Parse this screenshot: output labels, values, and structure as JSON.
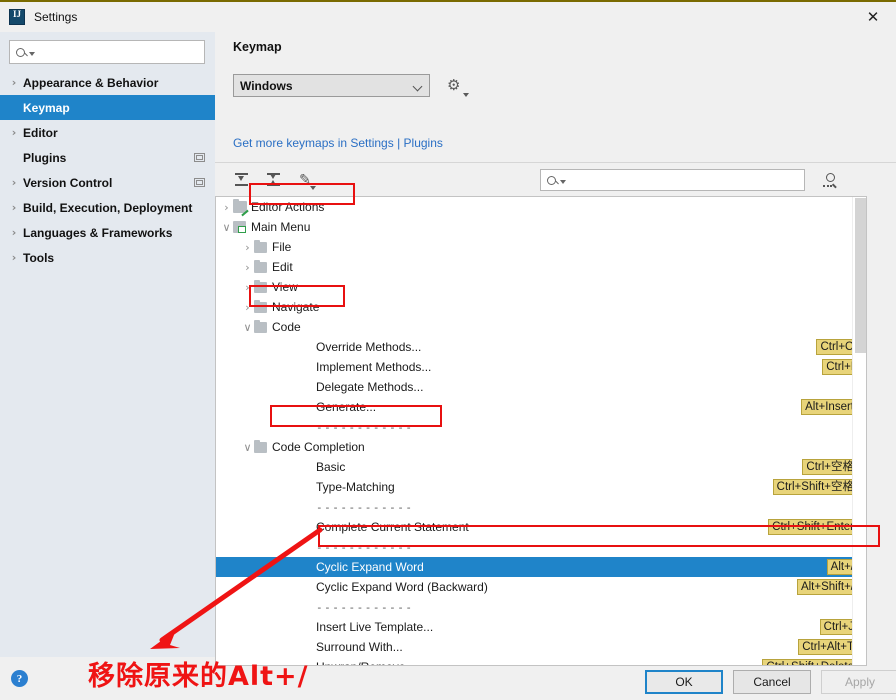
{
  "window": {
    "title": "Settings",
    "app_icon": "intellij-idea-icon",
    "close_icon": "close-icon"
  },
  "sidebar": {
    "search": {
      "placeholder": "",
      "value": "",
      "icon": "search-icon"
    },
    "items": [
      {
        "label": "Appearance & Behavior",
        "arrow": "›",
        "selected": false,
        "badge": false
      },
      {
        "label": "Keymap",
        "arrow": "",
        "selected": true,
        "badge": false
      },
      {
        "label": "Editor",
        "arrow": "›",
        "selected": false,
        "badge": false
      },
      {
        "label": "Plugins",
        "arrow": "",
        "selected": false,
        "badge": true
      },
      {
        "label": "Version Control",
        "arrow": "›",
        "selected": false,
        "badge": true
      },
      {
        "label": "Build, Execution, Deployment",
        "arrow": "›",
        "selected": false,
        "badge": false
      },
      {
        "label": "Languages & Frameworks",
        "arrow": "›",
        "selected": false,
        "badge": false
      },
      {
        "label": "Tools",
        "arrow": "›",
        "selected": false,
        "badge": false
      }
    ],
    "help_icon": "help-icon",
    "help_label": "?"
  },
  "main": {
    "page_title": "Keymap",
    "keymap_select": {
      "value": "Windows",
      "options": [
        "Windows"
      ]
    },
    "gear_icon": "gear-icon",
    "link_text": "Get more keymaps in Settings | Plugins",
    "toolbar": {
      "expand_all_icon": "expand-all-icon",
      "collapse_all_icon": "collapse-all-icon",
      "edit_shortcut_icon": "pencil-edit-icon",
      "search_placeholder": "",
      "search_value": "",
      "search_icon": "search-icon",
      "find_action_icon": "find-action-by-shortcut-icon"
    }
  },
  "tree": {
    "rows": [
      {
        "indent": 0,
        "twist": "›",
        "icon": "edit-actions-icon",
        "label": "Editor Actions",
        "shortcut": "",
        "selected": false,
        "kind": "editicon"
      },
      {
        "indent": 0,
        "twist": "∨",
        "icon": "main-menu-icon",
        "label": "Main Menu",
        "shortcut": "",
        "selected": false,
        "kind": "menuicon"
      },
      {
        "indent": 1,
        "twist": "›",
        "icon": "folder-icon",
        "label": "File",
        "shortcut": "",
        "selected": false,
        "kind": "folder"
      },
      {
        "indent": 1,
        "twist": "›",
        "icon": "folder-icon",
        "label": "Edit",
        "shortcut": "",
        "selected": false,
        "kind": "folder"
      },
      {
        "indent": 1,
        "twist": "›",
        "icon": "folder-icon",
        "label": "View",
        "shortcut": "",
        "selected": false,
        "kind": "folder"
      },
      {
        "indent": 1,
        "twist": "›",
        "icon": "folder-icon",
        "label": "Navigate",
        "shortcut": "",
        "selected": false,
        "kind": "folder"
      },
      {
        "indent": 1,
        "twist": "∨",
        "icon": "folder-icon",
        "label": "Code",
        "shortcut": "",
        "selected": false,
        "kind": "folder"
      },
      {
        "indent": 2,
        "twist": "",
        "icon": "",
        "label": "Override Methods...",
        "shortcut": "Ctrl+O",
        "selected": false,
        "kind": "leaf"
      },
      {
        "indent": 2,
        "twist": "",
        "icon": "",
        "label": "Implement Methods...",
        "shortcut": "Ctrl+I",
        "selected": false,
        "kind": "leaf"
      },
      {
        "indent": 2,
        "twist": "",
        "icon": "",
        "label": "Delegate Methods...",
        "shortcut": "",
        "selected": false,
        "kind": "leaf"
      },
      {
        "indent": 2,
        "twist": "",
        "icon": "",
        "label": "Generate...",
        "shortcut": "Alt+Insert",
        "selected": false,
        "kind": "leaf"
      },
      {
        "indent": 2,
        "twist": "",
        "icon": "",
        "label": "------------",
        "shortcut": "",
        "selected": false,
        "kind": "separator"
      },
      {
        "indent": 1,
        "twist": "∨",
        "icon": "folder-icon",
        "label": "Code Completion",
        "shortcut": "",
        "selected": false,
        "kind": "folder"
      },
      {
        "indent": 3,
        "twist": "",
        "icon": "",
        "label": "Basic",
        "shortcut": "Ctrl+空格",
        "selected": false,
        "kind": "leaf"
      },
      {
        "indent": 3,
        "twist": "",
        "icon": "",
        "label": "Type-Matching",
        "shortcut": "Ctrl+Shift+空格",
        "selected": false,
        "kind": "leaf"
      },
      {
        "indent": 3,
        "twist": "",
        "icon": "",
        "label": "------------",
        "shortcut": "",
        "selected": false,
        "kind": "separator"
      },
      {
        "indent": 3,
        "twist": "",
        "icon": "",
        "label": "Complete Current Statement",
        "shortcut": "Ctrl+Shift+Enter",
        "selected": false,
        "kind": "leaf"
      },
      {
        "indent": 3,
        "twist": "",
        "icon": "",
        "label": "------------",
        "shortcut": "",
        "selected": false,
        "kind": "separator"
      },
      {
        "indent": 3,
        "twist": "",
        "icon": "",
        "label": "Cyclic Expand Word",
        "shortcut": "Alt+/",
        "selected": true,
        "kind": "leaf"
      },
      {
        "indent": 3,
        "twist": "",
        "icon": "",
        "label": "Cyclic Expand Word (Backward)",
        "shortcut": "Alt+Shift+/",
        "selected": false,
        "kind": "leaf"
      },
      {
        "indent": 2,
        "twist": "",
        "icon": "",
        "label": "------------",
        "shortcut": "",
        "selected": false,
        "kind": "separator"
      },
      {
        "indent": 2,
        "twist": "",
        "icon": "",
        "label": "Insert Live Template...",
        "shortcut": "Ctrl+J",
        "selected": false,
        "kind": "leaf"
      },
      {
        "indent": 2,
        "twist": "",
        "icon": "",
        "label": "Surround With...",
        "shortcut": "Ctrl+Alt+T",
        "selected": false,
        "kind": "leaf"
      },
      {
        "indent": 2,
        "twist": "",
        "icon": "",
        "label": "Unwrap/Remove...",
        "shortcut": "Ctrl+Shift+Delete",
        "selected": false,
        "kind": "leaf"
      }
    ]
  },
  "annotation": {
    "text": "移除原来的Alt+/",
    "color": "#ef1414",
    "arrow_icon": "annotation-arrow-icon",
    "highlight_boxes": [
      "main-menu",
      "code",
      "code-completion",
      "cyclic-expand-word"
    ]
  },
  "buttons": {
    "ok": "OK",
    "cancel": "Cancel",
    "apply": "Apply"
  },
  "colors": {
    "selection_blue": "#1f84c9",
    "shortcut_badge": "#e8d47a",
    "annotation_red": "#ef1414",
    "link_blue": "#2a6fc4"
  }
}
